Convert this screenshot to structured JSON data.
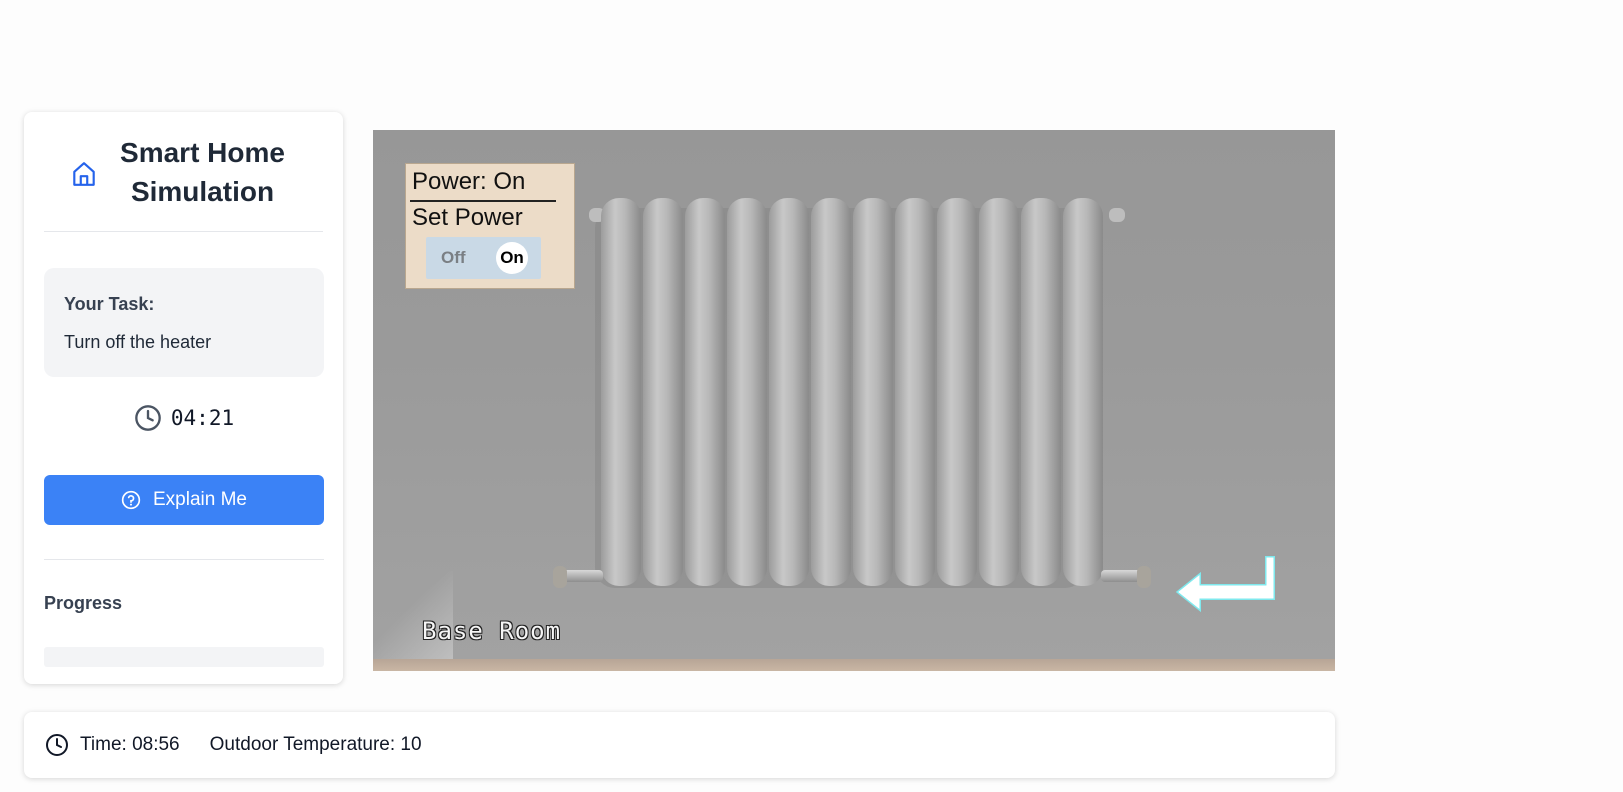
{
  "sidebar": {
    "title": "Smart Home Simulation",
    "home_icon": "home-icon",
    "task": {
      "heading": "Your Task:",
      "text": "Turn off the heater"
    },
    "timer": {
      "icon": "clock-icon",
      "value": "04:21"
    },
    "explain_button": {
      "label": "Explain Me",
      "icon": "help-circle-icon"
    },
    "progress": {
      "label": "Progress"
    }
  },
  "scene": {
    "room_label": "Base Room",
    "device": "radiator",
    "panel": {
      "status": "Power: On",
      "set_label": "Set Power",
      "toggle_off": "Off",
      "toggle_on": "On",
      "state": "on"
    },
    "back_icon": "return-arrow-icon"
  },
  "statusbar": {
    "icon": "clock-icon",
    "time": "Time: 08:56",
    "temperature": "Outdoor Temperature: 10"
  },
  "colors": {
    "accent": "#3b82f6",
    "panel_bg": "#ecdcc8",
    "toggle_bg": "#c9d9e6"
  }
}
